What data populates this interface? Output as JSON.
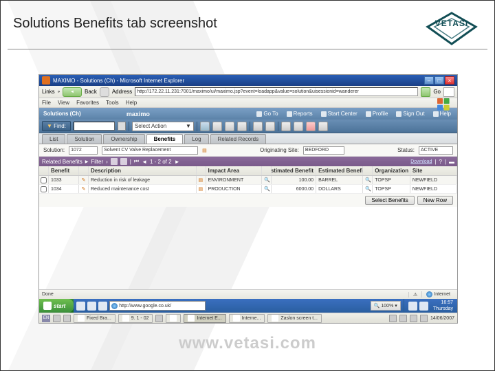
{
  "slide": {
    "title": "Solutions Benefits tab screenshot",
    "logo_text": "VETASI",
    "footer_wm": "www.vetasi.com"
  },
  "browser": {
    "title": "MAXIMO - Solutions (Ch) - Microsoft Internet Explorer",
    "links_label": "Links",
    "back": "Back",
    "address_label": "Address",
    "url": "http://172.22.11.231:7001/maximo/ui/maximo.jsp?event=loadapp&value=solution&uisessionid=wanderer",
    "menu": [
      "File",
      "View",
      "Favorites",
      "Tools",
      "Help"
    ],
    "go": "Go"
  },
  "maximo": {
    "app": "Solutions (Ch)",
    "brand": "maximo",
    "nav": [
      {
        "label": "Go To"
      },
      {
        "label": "Reports"
      },
      {
        "label": "Start Center"
      },
      {
        "label": "Profile"
      },
      {
        "label": "Sign Out"
      },
      {
        "label": "Help"
      }
    ],
    "find_label": "Find:",
    "select_action_label": "Select Action"
  },
  "tabs": [
    "List",
    "Solution",
    "Ownership",
    "Benefits",
    "Log",
    "Related Records"
  ],
  "active_tab": "Benefits",
  "form": {
    "solution_label": "Solution:",
    "solution_value": "1072",
    "solution_desc": "Solvent CV Valve Replacement",
    "orig_site_label": "Originating Site:",
    "orig_site_value": "BEDFORD",
    "status_label": "Status:",
    "status_value": "ACTIVE"
  },
  "section": {
    "title": "Related Benefits",
    "filter": "Filter",
    "pager": "1 - 2 of 2",
    "download": "Download",
    "help": "?"
  },
  "grid": {
    "columns": [
      "Benefit",
      "Description",
      "Impact Area",
      "Estimated Benefit",
      "Estimated Benefit Units",
      "Organization",
      "Site"
    ],
    "rows": [
      {
        "benefit": "1033",
        "desc": "Reduction in risk of leakage",
        "impact": "ENVIRONMENT",
        "est": "100.00",
        "unit": "BARREL",
        "org": "TOPSP",
        "site": "NEWFIELD"
      },
      {
        "benefit": "1034",
        "desc": "Reduced maintenance cost",
        "impact": "PRODUCTION",
        "est": "6000.00",
        "unit": "DOLLARS",
        "org": "TOPSP",
        "site": "NEWFIELD"
      }
    ],
    "select_benefits": "Select Benefits",
    "new_row": "New Row"
  },
  "statusbar": {
    "done": "Done",
    "zone": "Internet"
  },
  "taskbar": {
    "start": "start",
    "tasks": [
      "Fixed Bra...",
      "9. 1 - 02",
      "Internet E...",
      "Interne...",
      "Zaslon screen t..."
    ],
    "address": "http://www.google.co.uk/",
    "zoom": "100%",
    "clock_time": "16:57",
    "clock_date": "Thursday",
    "clock_full": "14/06/2007",
    "lang": "EN"
  }
}
